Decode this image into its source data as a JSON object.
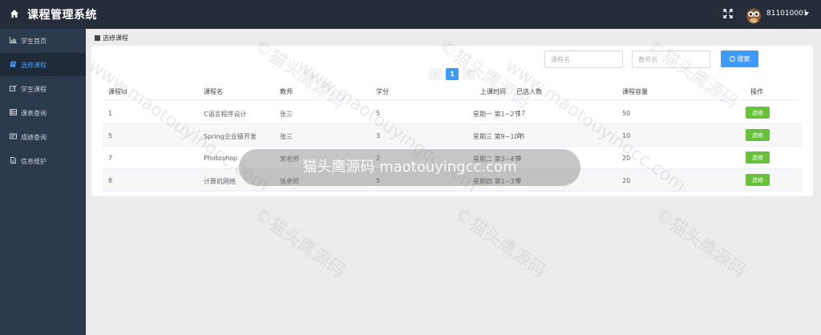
{
  "header": {
    "title": "课程管理系统",
    "username": "811010001",
    "icons": [
      "home-icon",
      "fullscreen-icon",
      "owl-avatar",
      "caret-down-icon"
    ]
  },
  "sidebar": {
    "items": [
      {
        "label": "学生首页",
        "icon": "chart-icon",
        "active": false
      },
      {
        "label": "选修课程",
        "icon": "book-icon",
        "active": true
      },
      {
        "label": "学生课程",
        "icon": "edit-icon",
        "active": false
      },
      {
        "label": "课表查询",
        "icon": "table-icon",
        "active": false
      },
      {
        "label": "成绩查询",
        "icon": "card-icon",
        "active": false
      },
      {
        "label": "信息维护",
        "icon": "file-icon",
        "active": false
      }
    ]
  },
  "breadcrumb": "选修课程",
  "search": {
    "course_placeholder": "课程名",
    "teacher_placeholder": "教师名",
    "button_label": "搜索"
  },
  "pagination": {
    "prev": "‹",
    "current": "1",
    "next": "›"
  },
  "table": {
    "headers": [
      "课程Id",
      "课程名",
      "教师",
      "学分",
      "上课时间",
      "已选人数",
      "课程容量",
      "操作"
    ],
    "rows": [
      {
        "id": "1",
        "name": "C语言程序设计",
        "teacher": "张三",
        "credit": "5",
        "time": "星期一 第1~2节",
        "enrolled": "17",
        "capacity": "50",
        "action": "选修"
      },
      {
        "id": "5",
        "name": "Spring企业级开发",
        "teacher": "张三",
        "credit": "3",
        "time": "星期三 第9~10节",
        "enrolled": "0",
        "capacity": "10",
        "action": "选修"
      },
      {
        "id": "7",
        "name": "Photoshop",
        "teacher": "宋老师",
        "credit": "2",
        "time": "星期二 第3~4节",
        "enrolled": "0",
        "capacity": "20",
        "action": "选修"
      },
      {
        "id": "8",
        "name": "计算机网络",
        "teacher": "张老师",
        "credit": "5",
        "time": "星期四 第1~3节",
        "enrolled": "0",
        "capacity": "20",
        "action": "选修"
      }
    ]
  },
  "watermark": {
    "pill": "猫头鹰源码 maotouyingcc.com",
    "diagonal_a": "©猫头鹰源码",
    "diagonal_b": "www.maotouyingcc.com"
  },
  "colors": {
    "topbar": "#252d3a",
    "sidebar": "#2b3a4d",
    "accent": "#3c9bff",
    "success": "#67c23a"
  }
}
